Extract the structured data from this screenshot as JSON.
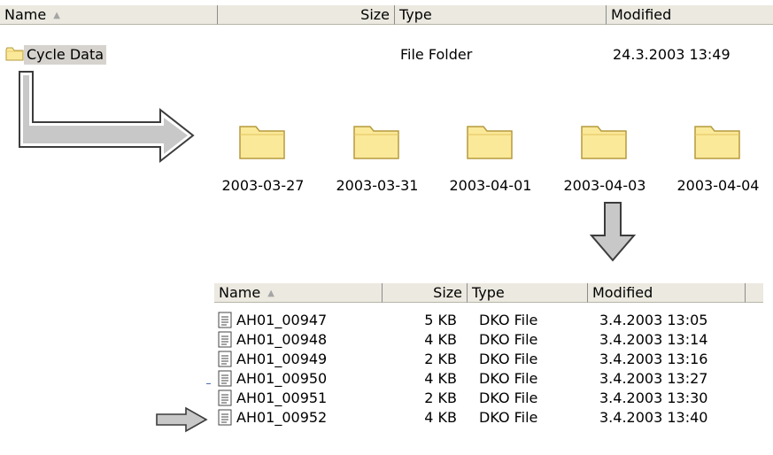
{
  "top_list": {
    "columns": {
      "name": "Name",
      "size": "Size",
      "type": "Type",
      "modified": "Modified"
    },
    "row": {
      "name": "Cycle Data",
      "type": "File Folder",
      "modified": "24.3.2003 13:49"
    }
  },
  "folders": [
    "2003-03-27",
    "2003-03-31",
    "2003-04-01",
    "2003-04-03",
    "2003-04-04"
  ],
  "bottom_list": {
    "columns": {
      "name": "Name",
      "size": "Size",
      "type": "Type",
      "modified": "Modified"
    },
    "rows": [
      {
        "name": "AH01_00947",
        "size": "5 KB",
        "type": "DKO File",
        "modified": "3.4.2003 13:05"
      },
      {
        "name": "AH01_00948",
        "size": "4 KB",
        "type": "DKO File",
        "modified": "3.4.2003 13:14"
      },
      {
        "name": "AH01_00949",
        "size": "2 KB",
        "type": "DKO File",
        "modified": "3.4.2003 13:16"
      },
      {
        "name": "AH01_00950",
        "size": "4 KB",
        "type": "DKO File",
        "modified": "3.4.2003 13:27"
      },
      {
        "name": "AH01_00951",
        "size": "2 KB",
        "type": "DKO File",
        "modified": "3.4.2003 13:30"
      },
      {
        "name": "AH01_00952",
        "size": "4 KB",
        "type": "DKO File",
        "modified": "3.4.2003 13:40"
      }
    ]
  },
  "colors": {
    "header_bg": "#ebe9e0",
    "folder_fill": "#fbe99a",
    "folder_stroke": "#b59a3d",
    "arrow_fill": "#c8c8c8"
  },
  "icons": {
    "small_folder": "folder-icon",
    "large_folder": "folder-icon",
    "file": "document-icon",
    "sort": "sort-ascending-icon"
  }
}
